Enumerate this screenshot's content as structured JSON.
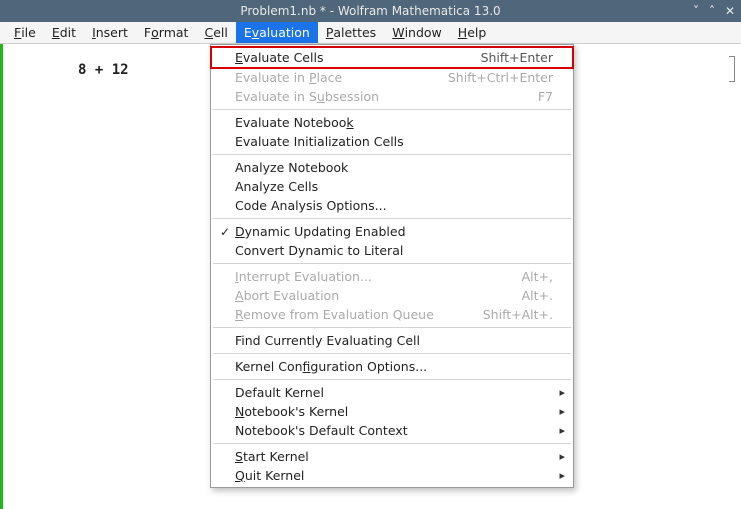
{
  "window": {
    "title": "Problem1.nb * - Wolfram Mathematica 13.0"
  },
  "menubar": {
    "items": [
      {
        "pre": "",
        "u": "F",
        "post": "ile"
      },
      {
        "pre": "",
        "u": "E",
        "post": "dit"
      },
      {
        "pre": "",
        "u": "I",
        "post": "nsert"
      },
      {
        "pre": "F",
        "u": "o",
        "post": "rmat"
      },
      {
        "pre": "",
        "u": "C",
        "post": "ell"
      },
      {
        "pre": "E",
        "u": "v",
        "post": "aluation"
      },
      {
        "pre": "",
        "u": "P",
        "post": "alettes"
      },
      {
        "pre": "",
        "u": "W",
        "post": "indow"
      },
      {
        "pre": "",
        "u": "H",
        "post": "elp"
      }
    ],
    "active_index": 5
  },
  "notebook": {
    "cell_text": "8 + 12"
  },
  "dropdown": {
    "rows": [
      {
        "type": "item",
        "pre": "",
        "u": "E",
        "post": "valuate Cells",
        "accel": "Shift+Enter",
        "highlight": true
      },
      {
        "type": "item",
        "pre": "Evaluate in ",
        "u": "P",
        "post": "lace",
        "accel": "Shift+Ctrl+Enter",
        "disabled": true
      },
      {
        "type": "item",
        "pre": "Evaluate in S",
        "u": "u",
        "post": "bsession",
        "accel": "F7",
        "disabled": true
      },
      {
        "type": "sep"
      },
      {
        "type": "item",
        "pre": "Evaluate Noteboo",
        "u": "k",
        "post": ""
      },
      {
        "type": "item",
        "pre": "Evaluate Initialization Cells",
        "u": "",
        "post": ""
      },
      {
        "type": "sep"
      },
      {
        "type": "item",
        "pre": "Analyze Notebook",
        "u": "",
        "post": ""
      },
      {
        "type": "item",
        "pre": "Analyze Cells",
        "u": "",
        "post": ""
      },
      {
        "type": "item",
        "pre": "Code Analysis Options...",
        "u": "",
        "post": ""
      },
      {
        "type": "sep"
      },
      {
        "type": "item",
        "pre": "",
        "u": "D",
        "post": "ynamic Updating Enabled",
        "check": "✓"
      },
      {
        "type": "item",
        "pre": "Convert Dynamic to Literal",
        "u": "",
        "post": ""
      },
      {
        "type": "sep"
      },
      {
        "type": "item",
        "pre": "",
        "u": "I",
        "post": "nterrupt Evaluation...",
        "accel": "Alt+,",
        "disabled": true
      },
      {
        "type": "item",
        "pre": "",
        "u": "A",
        "post": "bort Evaluation",
        "accel": "Alt+.",
        "disabled": true
      },
      {
        "type": "item",
        "pre": "",
        "u": "R",
        "post": "emove from Evaluation Queue",
        "accel": "Shift+Alt+.",
        "disabled": true
      },
      {
        "type": "sep"
      },
      {
        "type": "item",
        "pre": "Find Currently Evaluating Cell",
        "u": "",
        "post": ""
      },
      {
        "type": "sep"
      },
      {
        "type": "item",
        "pre": "Kernel Con",
        "u": "f",
        "post": "iguration Options..."
      },
      {
        "type": "sep"
      },
      {
        "type": "item",
        "pre": "Default Kernel",
        "u": "",
        "post": "",
        "submenu": true
      },
      {
        "type": "item",
        "pre": "",
        "u": "N",
        "post": "otebook's Kernel",
        "submenu": true
      },
      {
        "type": "item",
        "pre": "Notebook's Default Context",
        "u": "",
        "post": "",
        "submenu": true
      },
      {
        "type": "sep"
      },
      {
        "type": "item",
        "pre": "",
        "u": "S",
        "post": "tart Kernel",
        "submenu": true
      },
      {
        "type": "item",
        "pre": "",
        "u": "Q",
        "post": "uit Kernel",
        "submenu": true
      }
    ]
  }
}
